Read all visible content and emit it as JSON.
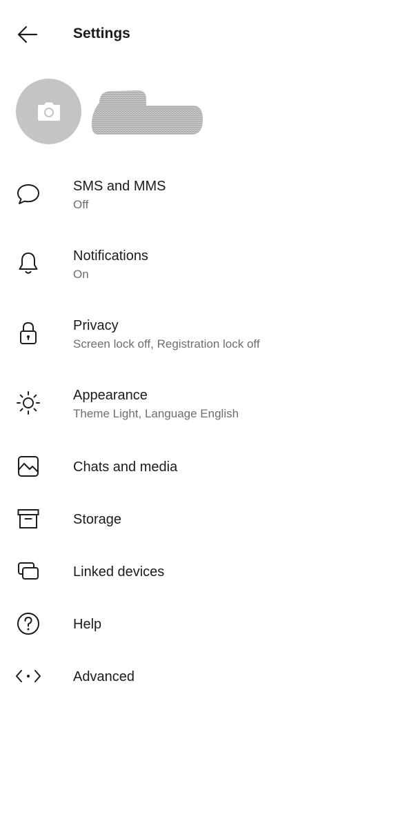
{
  "header": {
    "title": "Settings",
    "back_icon": "arrow-left-icon"
  },
  "profile": {
    "avatar_icon": "camera-icon",
    "name": ""
  },
  "settings": {
    "items": [
      {
        "label": "SMS and MMS",
        "sub": "Off",
        "icon": "chat-bubble-icon"
      },
      {
        "label": "Notifications",
        "sub": "On",
        "icon": "bell-icon"
      },
      {
        "label": "Privacy",
        "sub": "Screen lock off, Registration lock off",
        "icon": "lock-icon"
      },
      {
        "label": "Appearance",
        "sub": "Theme Light, Language English",
        "icon": "sun-icon"
      },
      {
        "label": "Chats and media",
        "icon": "image-icon"
      },
      {
        "label": "Storage",
        "icon": "archive-box-icon"
      },
      {
        "label": "Linked devices",
        "icon": "linked-devices-icon"
      },
      {
        "label": "Help",
        "icon": "help-circle-icon"
      },
      {
        "label": "Advanced",
        "icon": "code-icon"
      }
    ]
  },
  "colors": {
    "text_primary": "#1b1b1b",
    "text_secondary": "#6e6e6e",
    "avatar_bg": "#c4c4c4",
    "background": "#ffffff"
  }
}
